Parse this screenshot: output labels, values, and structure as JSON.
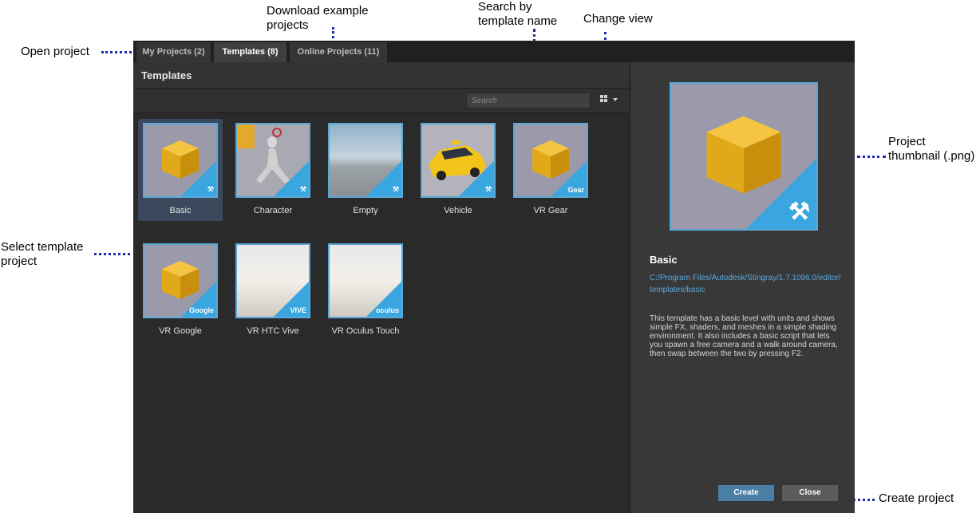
{
  "annotations": {
    "open_project": "Open project",
    "download_example_1": "Download example",
    "download_example_2": "projects",
    "search_by_1": "Search by",
    "search_by_2": "template name",
    "change_view": "Change view",
    "project_thumbnail_1": "Project",
    "project_thumbnail_2": "thumbnail (.png)",
    "select_template_1": "Select template",
    "select_template_2": "project",
    "create_project": "Create project"
  },
  "tabs": [
    {
      "label": "My Projects (2)",
      "active": false
    },
    {
      "label": "Templates (8)",
      "active": true
    },
    {
      "label": "Online Projects (11)",
      "active": false
    }
  ],
  "panel": {
    "title": "Templates",
    "search_placeholder": "Search"
  },
  "templates": [
    {
      "label": "Basic",
      "badge": "hammer-icon",
      "selected": true
    },
    {
      "label": "Character",
      "badge": "hammer-icon",
      "selected": false
    },
    {
      "label": "Empty",
      "badge": "hammer-icon",
      "selected": false
    },
    {
      "label": "Vehicle",
      "badge": "hammer-icon",
      "selected": false
    },
    {
      "label": "VR Gear",
      "badge": "Gear",
      "selected": false
    },
    {
      "label": "VR Google",
      "badge": "Google",
      "selected": false
    },
    {
      "label": "VR HTC Vive",
      "badge": "VIVE",
      "selected": false
    },
    {
      "label": "VR Oculus Touch",
      "badge": "oculus",
      "selected": false
    }
  ],
  "details": {
    "title": "Basic",
    "path": "C:/Program Files/Autodesk/Stingray/1.7.1096.0/editor/templates/basic",
    "description": "This template has a basic level with units and shows simple FX, shaders, and meshes in a simple shading environment. It also includes a basic script that lets you spawn a free camera and a walk around camera, then swap between the two by pressing F2.",
    "create_label": "Create",
    "close_label": "Close"
  },
  "colors": {
    "accent": "#3aa6e0",
    "annotation_dots": "#1f2bb5",
    "selected_card": "#3a4a5c"
  }
}
